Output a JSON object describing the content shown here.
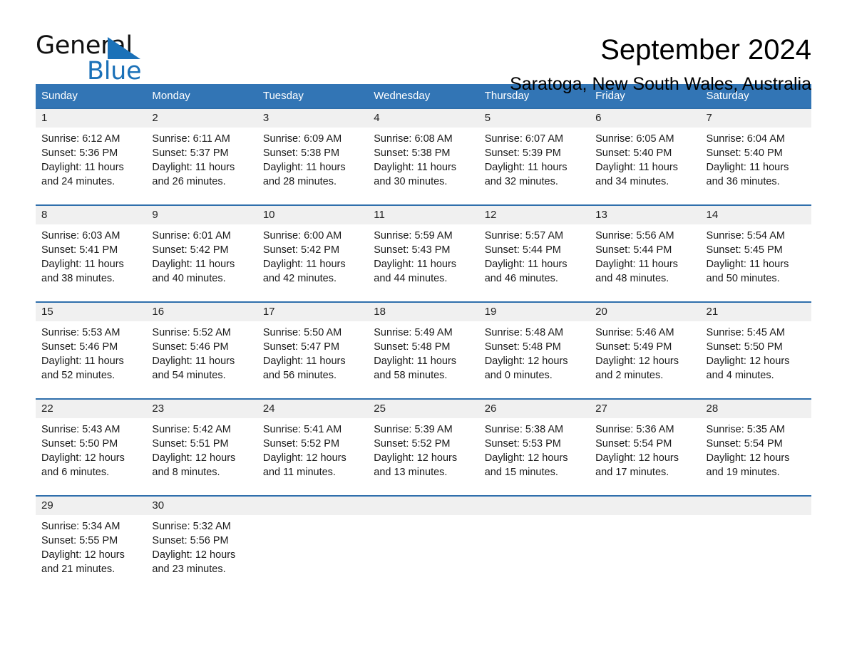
{
  "brand": {
    "name_primary": "General",
    "name_secondary": "Blue",
    "accent_color": "#1b71b8"
  },
  "header": {
    "month_title": "September 2024",
    "location": "Saratoga, New South Wales, Australia"
  },
  "theme": {
    "header_blue": "#3275b5",
    "row_divider_blue": "#2f6fac",
    "daynum_band": "#f0f0f0"
  },
  "weekdays": [
    "Sunday",
    "Monday",
    "Tuesday",
    "Wednesday",
    "Thursday",
    "Friday",
    "Saturday"
  ],
  "weeks": [
    [
      {
        "day": "1",
        "sunrise": "Sunrise: 6:12 AM",
        "sunset": "Sunset: 5:36 PM",
        "daylight_1": "Daylight: 11 hours",
        "daylight_2": "and 24 minutes."
      },
      {
        "day": "2",
        "sunrise": "Sunrise: 6:11 AM",
        "sunset": "Sunset: 5:37 PM",
        "daylight_1": "Daylight: 11 hours",
        "daylight_2": "and 26 minutes."
      },
      {
        "day": "3",
        "sunrise": "Sunrise: 6:09 AM",
        "sunset": "Sunset: 5:38 PM",
        "daylight_1": "Daylight: 11 hours",
        "daylight_2": "and 28 minutes."
      },
      {
        "day": "4",
        "sunrise": "Sunrise: 6:08 AM",
        "sunset": "Sunset: 5:38 PM",
        "daylight_1": "Daylight: 11 hours",
        "daylight_2": "and 30 minutes."
      },
      {
        "day": "5",
        "sunrise": "Sunrise: 6:07 AM",
        "sunset": "Sunset: 5:39 PM",
        "daylight_1": "Daylight: 11 hours",
        "daylight_2": "and 32 minutes."
      },
      {
        "day": "6",
        "sunrise": "Sunrise: 6:05 AM",
        "sunset": "Sunset: 5:40 PM",
        "daylight_1": "Daylight: 11 hours",
        "daylight_2": "and 34 minutes."
      },
      {
        "day": "7",
        "sunrise": "Sunrise: 6:04 AM",
        "sunset": "Sunset: 5:40 PM",
        "daylight_1": "Daylight: 11 hours",
        "daylight_2": "and 36 minutes."
      }
    ],
    [
      {
        "day": "8",
        "sunrise": "Sunrise: 6:03 AM",
        "sunset": "Sunset: 5:41 PM",
        "daylight_1": "Daylight: 11 hours",
        "daylight_2": "and 38 minutes."
      },
      {
        "day": "9",
        "sunrise": "Sunrise: 6:01 AM",
        "sunset": "Sunset: 5:42 PM",
        "daylight_1": "Daylight: 11 hours",
        "daylight_2": "and 40 minutes."
      },
      {
        "day": "10",
        "sunrise": "Sunrise: 6:00 AM",
        "sunset": "Sunset: 5:42 PM",
        "daylight_1": "Daylight: 11 hours",
        "daylight_2": "and 42 minutes."
      },
      {
        "day": "11",
        "sunrise": "Sunrise: 5:59 AM",
        "sunset": "Sunset: 5:43 PM",
        "daylight_1": "Daylight: 11 hours",
        "daylight_2": "and 44 minutes."
      },
      {
        "day": "12",
        "sunrise": "Sunrise: 5:57 AM",
        "sunset": "Sunset: 5:44 PM",
        "daylight_1": "Daylight: 11 hours",
        "daylight_2": "and 46 minutes."
      },
      {
        "day": "13",
        "sunrise": "Sunrise: 5:56 AM",
        "sunset": "Sunset: 5:44 PM",
        "daylight_1": "Daylight: 11 hours",
        "daylight_2": "and 48 minutes."
      },
      {
        "day": "14",
        "sunrise": "Sunrise: 5:54 AM",
        "sunset": "Sunset: 5:45 PM",
        "daylight_1": "Daylight: 11 hours",
        "daylight_2": "and 50 minutes."
      }
    ],
    [
      {
        "day": "15",
        "sunrise": "Sunrise: 5:53 AM",
        "sunset": "Sunset: 5:46 PM",
        "daylight_1": "Daylight: 11 hours",
        "daylight_2": "and 52 minutes."
      },
      {
        "day": "16",
        "sunrise": "Sunrise: 5:52 AM",
        "sunset": "Sunset: 5:46 PM",
        "daylight_1": "Daylight: 11 hours",
        "daylight_2": "and 54 minutes."
      },
      {
        "day": "17",
        "sunrise": "Sunrise: 5:50 AM",
        "sunset": "Sunset: 5:47 PM",
        "daylight_1": "Daylight: 11 hours",
        "daylight_2": "and 56 minutes."
      },
      {
        "day": "18",
        "sunrise": "Sunrise: 5:49 AM",
        "sunset": "Sunset: 5:48 PM",
        "daylight_1": "Daylight: 11 hours",
        "daylight_2": "and 58 minutes."
      },
      {
        "day": "19",
        "sunrise": "Sunrise: 5:48 AM",
        "sunset": "Sunset: 5:48 PM",
        "daylight_1": "Daylight: 12 hours",
        "daylight_2": "and 0 minutes."
      },
      {
        "day": "20",
        "sunrise": "Sunrise: 5:46 AM",
        "sunset": "Sunset: 5:49 PM",
        "daylight_1": "Daylight: 12 hours",
        "daylight_2": "and 2 minutes."
      },
      {
        "day": "21",
        "sunrise": "Sunrise: 5:45 AM",
        "sunset": "Sunset: 5:50 PM",
        "daylight_1": "Daylight: 12 hours",
        "daylight_2": "and 4 minutes."
      }
    ],
    [
      {
        "day": "22",
        "sunrise": "Sunrise: 5:43 AM",
        "sunset": "Sunset: 5:50 PM",
        "daylight_1": "Daylight: 12 hours",
        "daylight_2": "and 6 minutes."
      },
      {
        "day": "23",
        "sunrise": "Sunrise: 5:42 AM",
        "sunset": "Sunset: 5:51 PM",
        "daylight_1": "Daylight: 12 hours",
        "daylight_2": "and 8 minutes."
      },
      {
        "day": "24",
        "sunrise": "Sunrise: 5:41 AM",
        "sunset": "Sunset: 5:52 PM",
        "daylight_1": "Daylight: 12 hours",
        "daylight_2": "and 11 minutes."
      },
      {
        "day": "25",
        "sunrise": "Sunrise: 5:39 AM",
        "sunset": "Sunset: 5:52 PM",
        "daylight_1": "Daylight: 12 hours",
        "daylight_2": "and 13 minutes."
      },
      {
        "day": "26",
        "sunrise": "Sunrise: 5:38 AM",
        "sunset": "Sunset: 5:53 PM",
        "daylight_1": "Daylight: 12 hours",
        "daylight_2": "and 15 minutes."
      },
      {
        "day": "27",
        "sunrise": "Sunrise: 5:36 AM",
        "sunset": "Sunset: 5:54 PM",
        "daylight_1": "Daylight: 12 hours",
        "daylight_2": "and 17 minutes."
      },
      {
        "day": "28",
        "sunrise": "Sunrise: 5:35 AM",
        "sunset": "Sunset: 5:54 PM",
        "daylight_1": "Daylight: 12 hours",
        "daylight_2": "and 19 minutes."
      }
    ],
    [
      {
        "day": "29",
        "sunrise": "Sunrise: 5:34 AM",
        "sunset": "Sunset: 5:55 PM",
        "daylight_1": "Daylight: 12 hours",
        "daylight_2": "and 21 minutes."
      },
      {
        "day": "30",
        "sunrise": "Sunrise: 5:32 AM",
        "sunset": "Sunset: 5:56 PM",
        "daylight_1": "Daylight: 12 hours",
        "daylight_2": "and 23 minutes."
      },
      {
        "day": "",
        "sunrise": "",
        "sunset": "",
        "daylight_1": "",
        "daylight_2": ""
      },
      {
        "day": "",
        "sunrise": "",
        "sunset": "",
        "daylight_1": "",
        "daylight_2": ""
      },
      {
        "day": "",
        "sunrise": "",
        "sunset": "",
        "daylight_1": "",
        "daylight_2": ""
      },
      {
        "day": "",
        "sunrise": "",
        "sunset": "",
        "daylight_1": "",
        "daylight_2": ""
      },
      {
        "day": "",
        "sunrise": "",
        "sunset": "",
        "daylight_1": "",
        "daylight_2": ""
      }
    ]
  ]
}
